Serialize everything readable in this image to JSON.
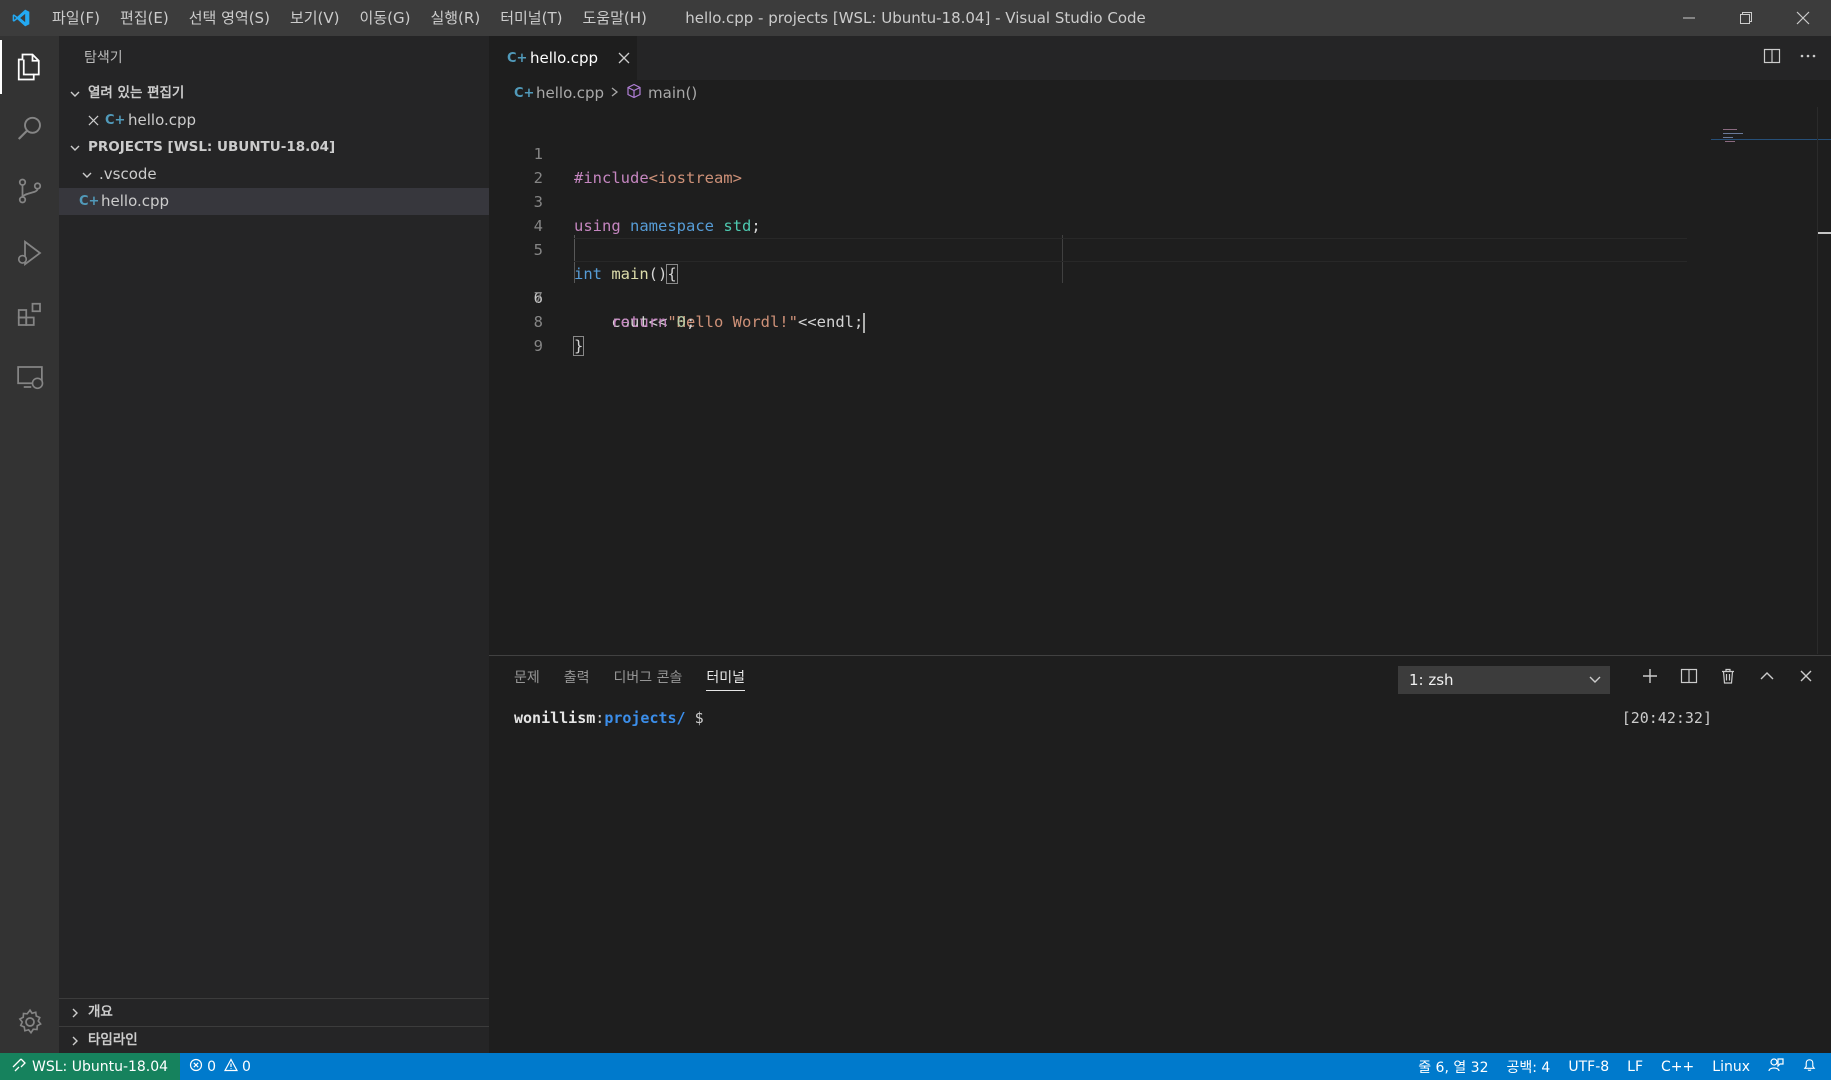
{
  "window": {
    "title": "hello.cpp - projects [WSL: Ubuntu-18.04] - Visual Studio Code"
  },
  "menu": [
    "파일(F)",
    "편집(E)",
    "선택 영역(S)",
    "보기(V)",
    "이동(G)",
    "실행(R)",
    "터미널(T)",
    "도움말(H)"
  ],
  "sidebar": {
    "title": "탐색기",
    "open_editors": {
      "header": "열려 있는 편집기",
      "items": [
        {
          "name": "hello.cpp"
        }
      ]
    },
    "workspace": {
      "header": "PROJECTS [WSL: UBUNTU-18.04]",
      "items": [
        {
          "name": ".vscode"
        },
        {
          "name": "hello.cpp"
        }
      ]
    },
    "outline": {
      "header": "개요"
    },
    "timeline": {
      "header": "타임라인"
    }
  },
  "editor": {
    "tab": {
      "label": "hello.cpp"
    },
    "breadcrumb": {
      "file": "hello.cpp",
      "symbol": "main()"
    },
    "line_numbers": [
      "1",
      "2",
      "3",
      "4",
      "5",
      "6",
      "7",
      "8",
      "9"
    ],
    "lines": {
      "l1": {
        "directive": "#include",
        "header": "<iostream>"
      },
      "l3": {
        "kw": "using",
        "kw2": "namespace",
        "ns": "std",
        "end": ";"
      },
      "l5": {
        "type": "int",
        "fn": "main",
        "rest": "()",
        "brace": "{"
      },
      "l6": {
        "indent": "    ",
        "obj": "cout",
        "op": "<<",
        "str": "\"Hello Wordl!\"",
        "op2": "<<",
        "endl": "endl",
        "end": ";"
      },
      "l7": {
        "indent": "    ",
        "kw": "return",
        "num": "0",
        "end": ";"
      },
      "l8": {
        "brace": "}"
      }
    }
  },
  "panel": {
    "tabs": [
      "문제",
      "출력",
      "디버그 콘솔",
      "터미널"
    ],
    "active_tab": "터미널",
    "terminal_select": "1: zsh",
    "prompt": {
      "user": "wonillism",
      "colon": ":",
      "path": "projects/",
      "dollar": " $"
    },
    "clock": "[20:42:32]"
  },
  "statusbar": {
    "remote": "WSL: Ubuntu-18.04",
    "errors": "0",
    "warnings": "0",
    "position": "줄 6, 열 32",
    "spaces": "공백: 4",
    "encoding": "UTF-8",
    "eol": "LF",
    "language": "C++",
    "os": "Linux"
  },
  "colors": {
    "statusbar": "#007acc",
    "remote": "#16825d",
    "activitybar": "#333333",
    "sidebar": "#252526",
    "editor": "#1e1e1e"
  }
}
